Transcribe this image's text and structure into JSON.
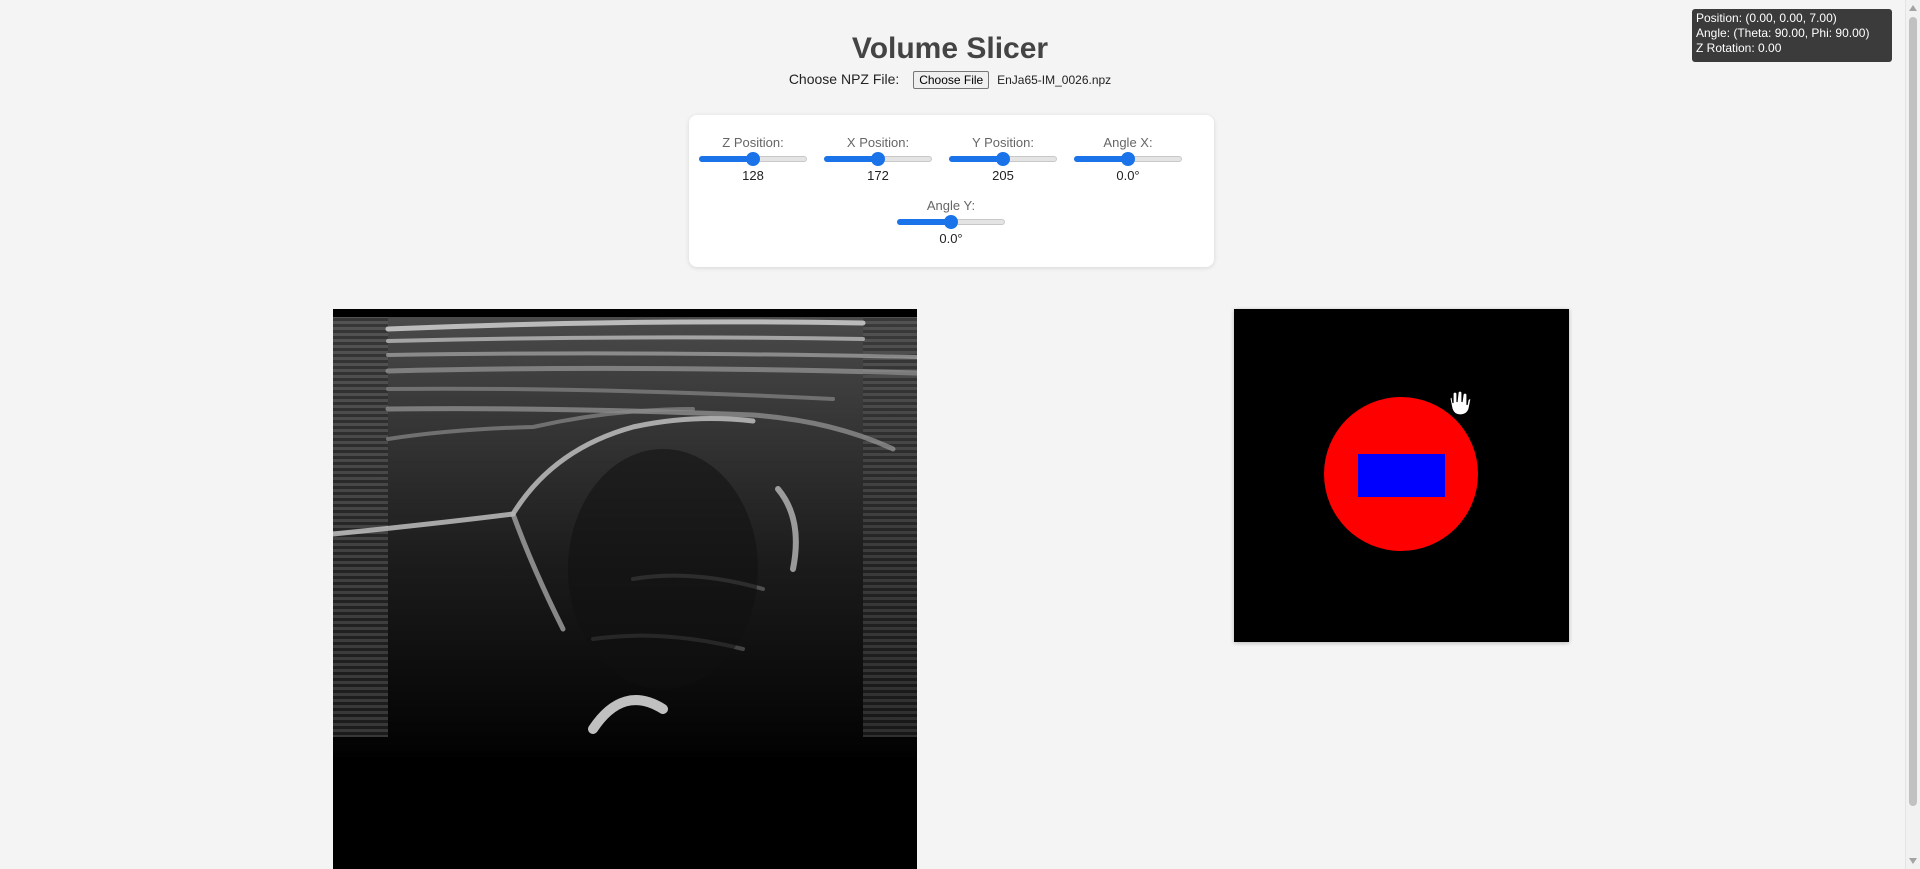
{
  "app": {
    "title": "Volume Slicer"
  },
  "file": {
    "label": "Choose NPZ File:",
    "button_label": "Choose File",
    "file_name": "EnJa65-IM_0026.npz"
  },
  "controls": [
    {
      "key": "z",
      "label": "Z Position:",
      "value": "128",
      "fraction": 0.5
    },
    {
      "key": "x",
      "label": "X Position:",
      "value": "172",
      "fraction": 0.5
    },
    {
      "key": "y",
      "label": "Y Position:",
      "value": "205",
      "fraction": 0.5
    },
    {
      "key": "angle-x",
      "label": "Angle X:",
      "value": "0.0°",
      "fraction": 0.5
    },
    {
      "key": "angle-y",
      "label": "Angle Y:",
      "value": "0.0°",
      "fraction": 0.5
    }
  ],
  "info": {
    "position": "Position: (0.00, 0.00, 7.00)",
    "angle": "Angle: (Theta: 90.00, Phi: 90.00)",
    "z_rotation": "Z Rotation: 0.00"
  },
  "colors": {
    "accent": "#1a73e8",
    "preview_circle": "#ff0000",
    "preview_rect": "#0000ff"
  },
  "icons": {
    "cursor": "hand-cursor-icon"
  }
}
